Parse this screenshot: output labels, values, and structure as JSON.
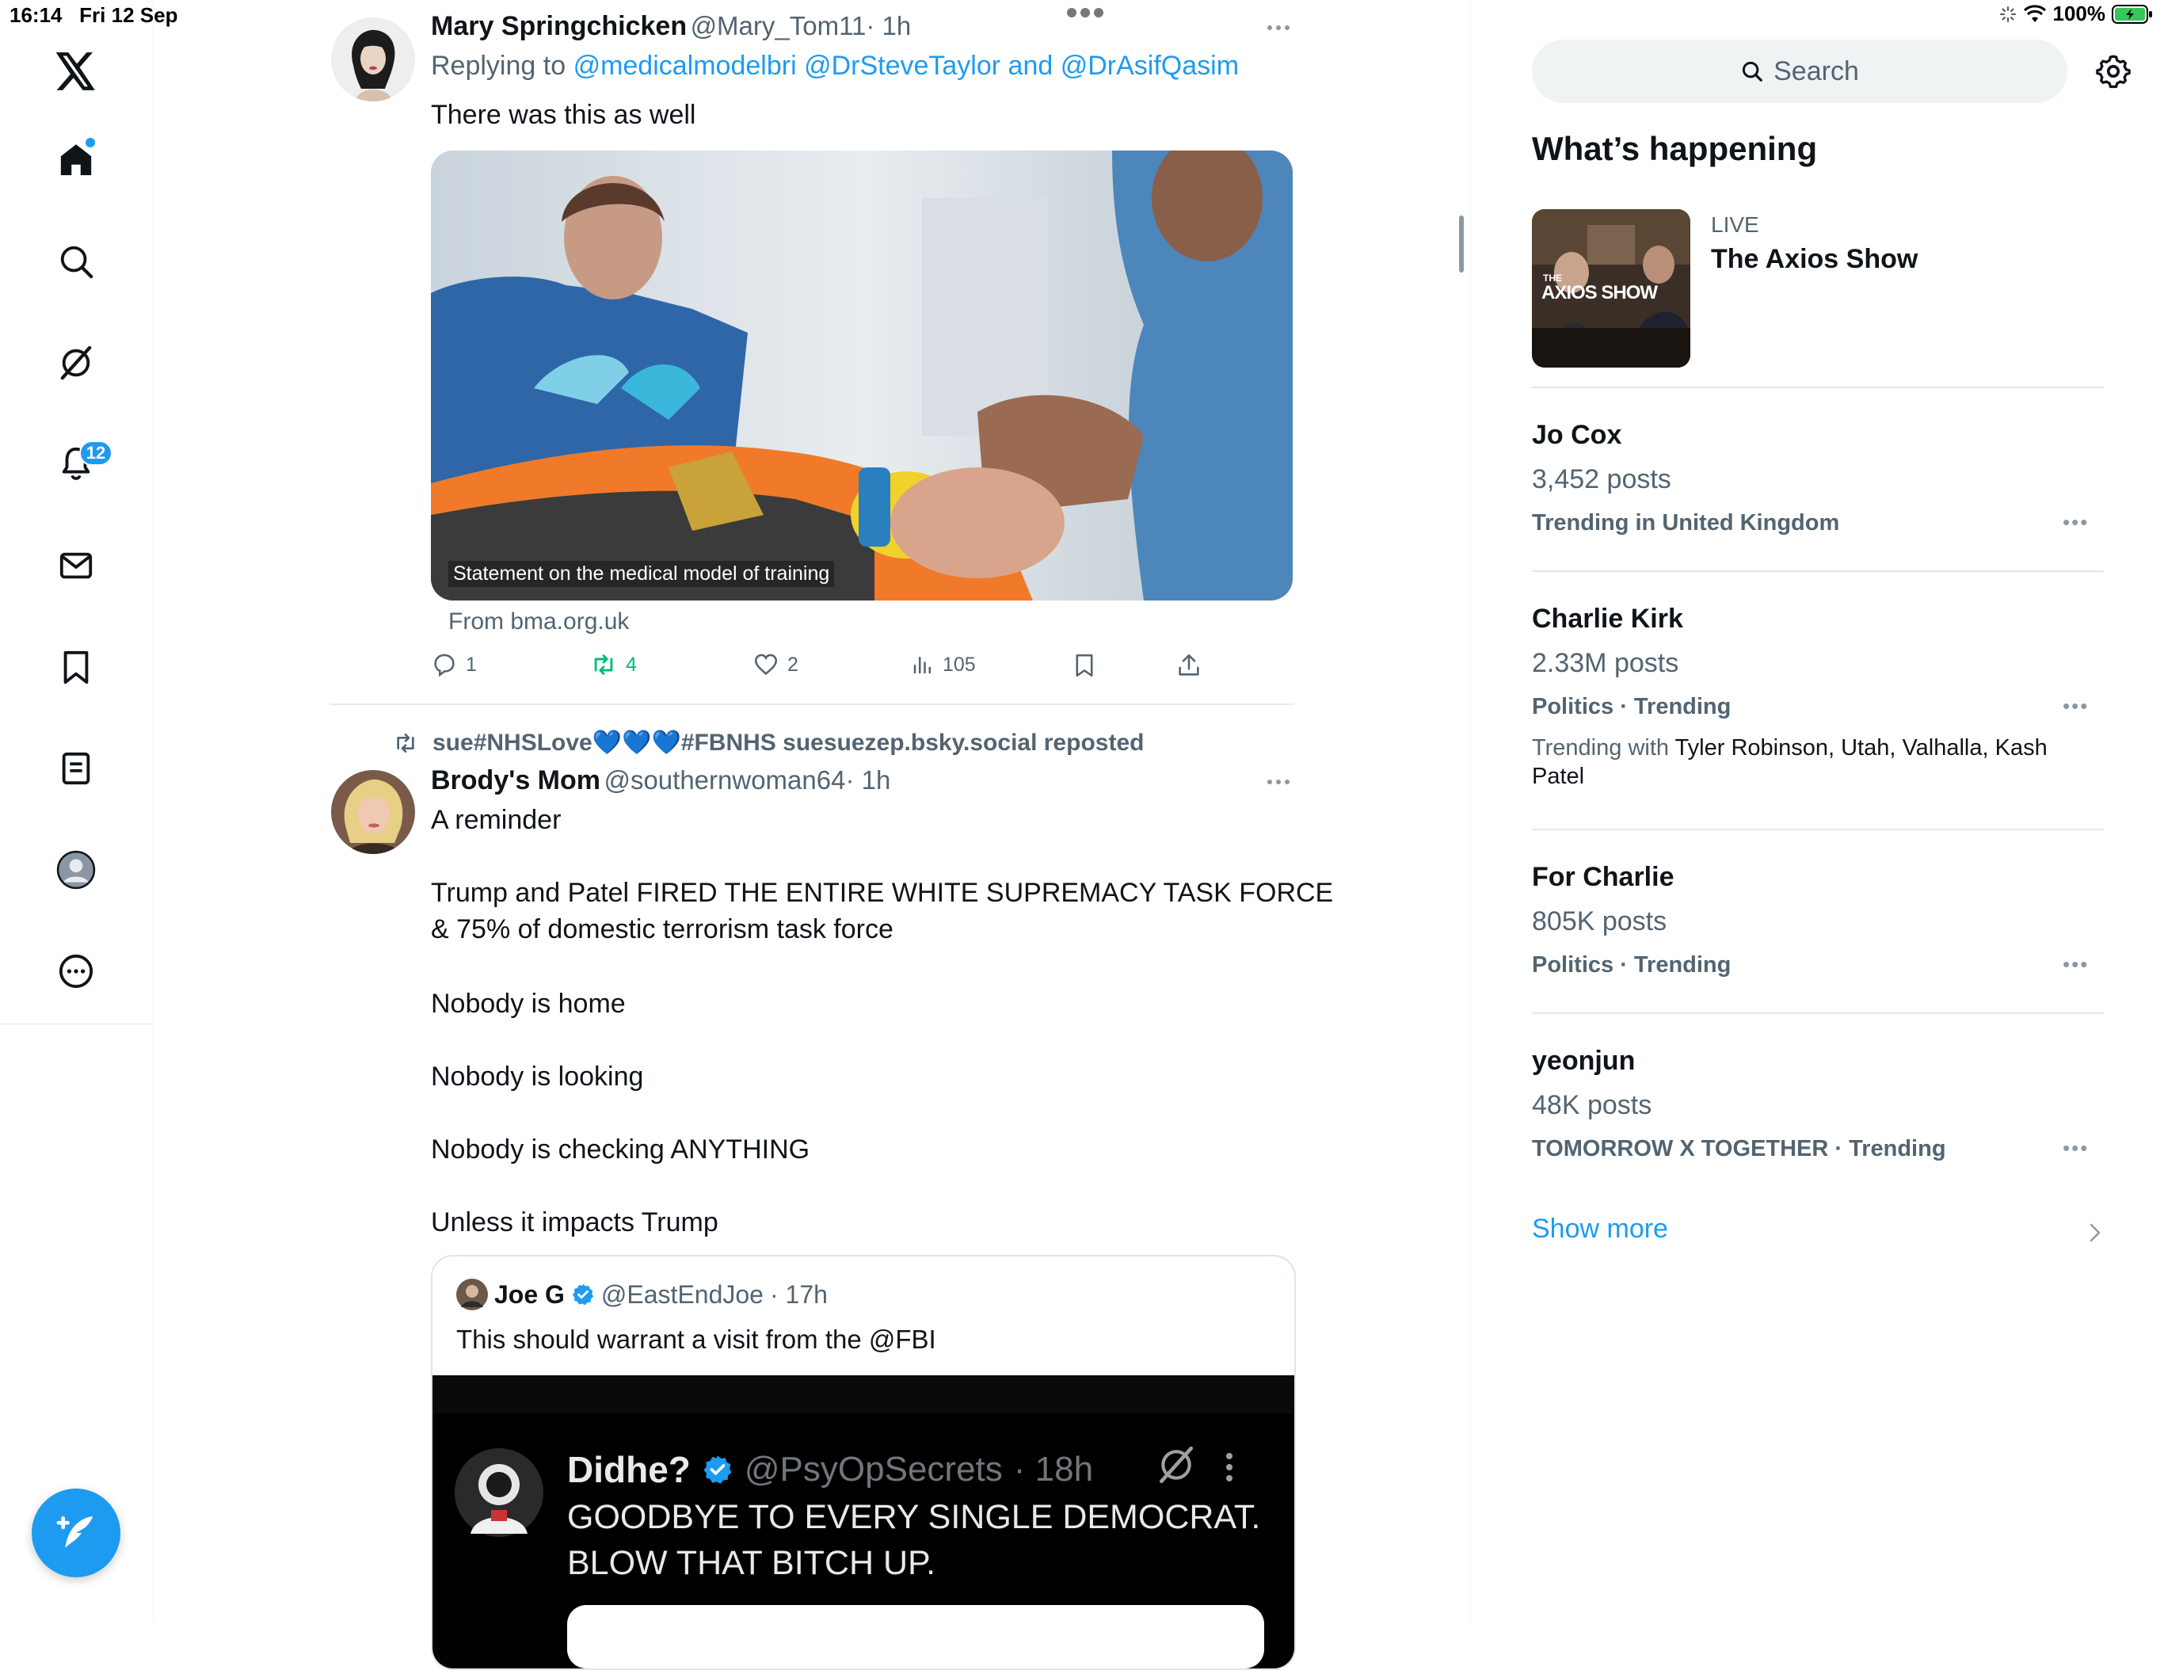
{
  "status": {
    "time": "16:14",
    "date": "Fri 12 Sep",
    "battery": "100%"
  },
  "nav": {
    "notifications_count": "12",
    "items": [
      "x-logo",
      "home-icon",
      "search-icon",
      "grok-icon",
      "bell-icon",
      "mail-icon",
      "bookmark-icon",
      "lists-icon",
      "profile-icon",
      "more-icon"
    ]
  },
  "feed": {
    "tweet1": {
      "name": "Mary Springchicken",
      "handle": "@Mary_Tom11",
      "time": "· 1h",
      "replying_prefix": "Replying to",
      "replying_to": "@medicalmodelbri @DrSteveTaylor and @DrAsifQasim",
      "text": "There was this as well",
      "media_caption": "Statement on the medical model of training",
      "link_source": "From bma.org.uk",
      "replies": "1",
      "reposts": "4",
      "likes": "2",
      "views": "105"
    },
    "repost_banner": "sue#NHSLove💙💙💙#FBNHS suesuezep.bsky.social reposted",
    "tweet2": {
      "name": "Brody's Mom",
      "handle": "@southernwoman64",
      "time": "· 1h",
      "lines": [
        "A reminder",
        "Trump and Patel FIRED THE ENTIRE WHITE SUPREMACY TASK FORCE",
        "& 75% of domestic terrorism task force",
        "Nobody is home",
        "Nobody is looking",
        "Nobody is checking ANYTHING",
        "Unless it impacts Trump"
      ],
      "quote": {
        "name": "Joe G",
        "handle": "@EastEndJoe",
        "time": "· 17h",
        "text": "This should warrant a visit from the @FBI",
        "inner": {
          "name": "Didhe?",
          "handle": "@PsyOpSecrets",
          "time": "· 18h",
          "line1": "GOODBYE TO EVERY SINGLE DEMOCRAT.",
          "line2": "BLOW THAT BITCH UP."
        }
      }
    }
  },
  "sidebar": {
    "search_placeholder": "Search",
    "title": "What’s happening",
    "live": {
      "label": "LIVE",
      "title": "The Axios Show",
      "thumb_text_small": "THE",
      "thumb_text": "AXIOS SHOW"
    },
    "trends": [
      {
        "title": "Jo Cox",
        "count": "3,452 posts",
        "meta": "Trending in United Kingdom"
      },
      {
        "title": "Charlie Kirk",
        "count": "2.33M posts",
        "meta": "Politics · Trending",
        "with_prefix": "Trending with",
        "with": " Tyler Robinson, Utah, Valhalla, Kash Patel"
      },
      {
        "title": "For Charlie",
        "count": "805K posts",
        "meta": "Politics · Trending"
      },
      {
        "title": "yeonjun",
        "count": "48K posts",
        "meta": "TOMORROW X TOGETHER · Trending"
      }
    ],
    "more_dots": "•••",
    "show_more": "Show more"
  },
  "colors": {
    "accent": "#1d9bf0",
    "repost_green": "#00ba7c",
    "text": "#0f1419",
    "muted": "#536471"
  }
}
